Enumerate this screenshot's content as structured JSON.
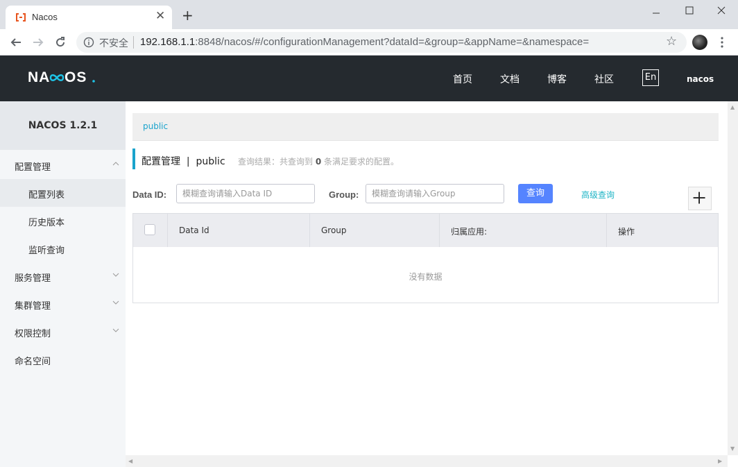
{
  "browser": {
    "tab_title": "Nacos",
    "insecure_label": "不安全",
    "url_host": "192.168.1.1",
    "url_rest": ":8848/nacos/#/configurationManagement?dataId=&group=&appName=&namespace="
  },
  "header": {
    "nav": [
      "首页",
      "文档",
      "博客",
      "社区"
    ],
    "lang": "En",
    "user": "nacos"
  },
  "sidebar": {
    "title": "NACOS 1.2.1",
    "items": [
      {
        "label": "配置管理",
        "expanded": true
      },
      {
        "label": "配置列表",
        "sub": true,
        "active": true
      },
      {
        "label": "历史版本",
        "sub": true
      },
      {
        "label": "监听查询",
        "sub": true
      },
      {
        "label": "服务管理"
      },
      {
        "label": "集群管理"
      },
      {
        "label": "权限控制"
      },
      {
        "label": "命名空间"
      }
    ]
  },
  "main": {
    "namespace": "public",
    "title": "配置管理  |  public",
    "result_prefix": "查询结果：共查询到",
    "result_count": "0",
    "result_suffix": "条满足要求的配置。",
    "dataid_label": "Data ID:",
    "dataid_placeholder": "模糊查询请输入Data ID",
    "group_label": "Group:",
    "group_placeholder": "模糊查询请输入Group",
    "query_button": "查询",
    "advanced_query": "高级查询",
    "columns": [
      "Data Id",
      "Group",
      "归属应用:",
      "操作"
    ],
    "empty_text": "没有数据"
  },
  "colors": {
    "header_bg": "#252a2f",
    "accent": "#1aa3cc",
    "button": "#5584ff"
  }
}
